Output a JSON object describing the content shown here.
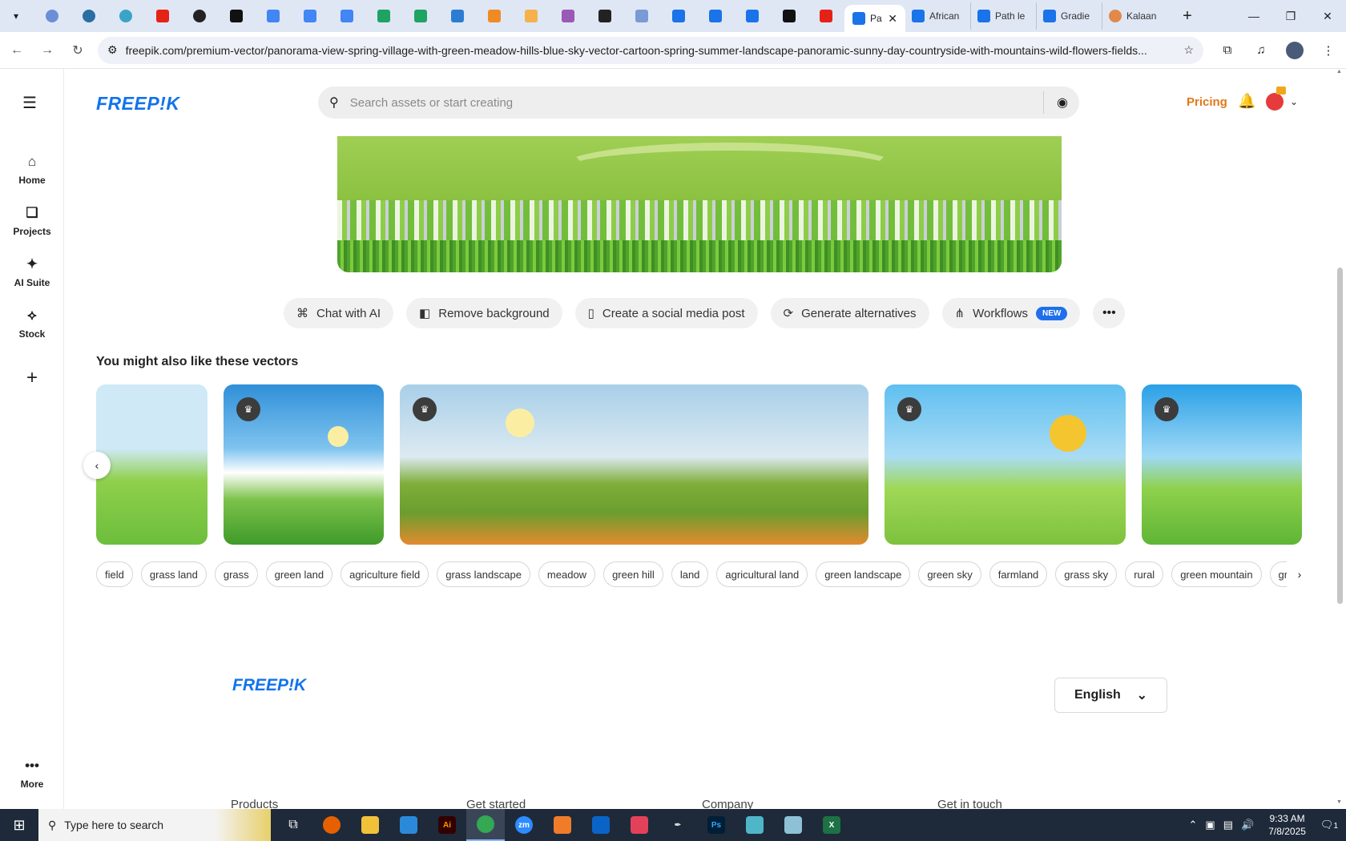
{
  "browser": {
    "tabs_pinned_count": 23,
    "active_tab": {
      "title": "Pa"
    },
    "named_tabs": [
      {
        "title": "African"
      },
      {
        "title": "Path le"
      },
      {
        "title": "Gradie"
      },
      {
        "title": "Kalaan"
      }
    ],
    "url": "freepik.com/premium-vector/panorama-view-spring-village-with-green-meadow-hills-blue-sky-vector-cartoon-spring-summer-landscape-panoramic-sunny-day-countryside-with-mountains-wild-flowers-fields..."
  },
  "leftnav": {
    "items": [
      {
        "label": "Home",
        "icon": "home-icon"
      },
      {
        "label": "Projects",
        "icon": "projects-icon"
      },
      {
        "label": "AI Suite",
        "icon": "sparkles-icon"
      },
      {
        "label": "Stock",
        "icon": "stock-icon"
      }
    ],
    "more_label": "More"
  },
  "header": {
    "logo": "FREEP!K",
    "search_placeholder": "Search assets or start creating",
    "pricing": "Pricing"
  },
  "actions": [
    {
      "label": "Chat with AI",
      "icon": "chat-ai-icon"
    },
    {
      "label": "Remove background",
      "icon": "remove-bg-icon"
    },
    {
      "label": "Create a social media post",
      "icon": "phone-icon"
    },
    {
      "label": "Generate alternatives",
      "icon": "refresh-icon"
    },
    {
      "label": "Workflows",
      "icon": "workflow-icon",
      "badge": "NEW"
    }
  ],
  "related": {
    "title": "You might also like these vectors"
  },
  "tags": [
    "field",
    "grass land",
    "grass",
    "green land",
    "agriculture field",
    "grass landscape",
    "meadow",
    "green hill",
    "land",
    "agricultural land",
    "green landscape",
    "green sky",
    "farmland",
    "grass sky",
    "rural",
    "green mountain",
    "gre"
  ],
  "footer": {
    "logo": "FREEP!K",
    "language": "English",
    "columns": [
      "Products",
      "Get started",
      "Company",
      "Get in touch"
    ]
  },
  "taskbar": {
    "search_placeholder": "Type here to search",
    "time": "9:33 AM",
    "date": "7/8/2025",
    "notification_count": "1"
  },
  "colors": {
    "brand": "#1273eb",
    "pricing": "#e0791a",
    "badge": "#1f6feb"
  }
}
